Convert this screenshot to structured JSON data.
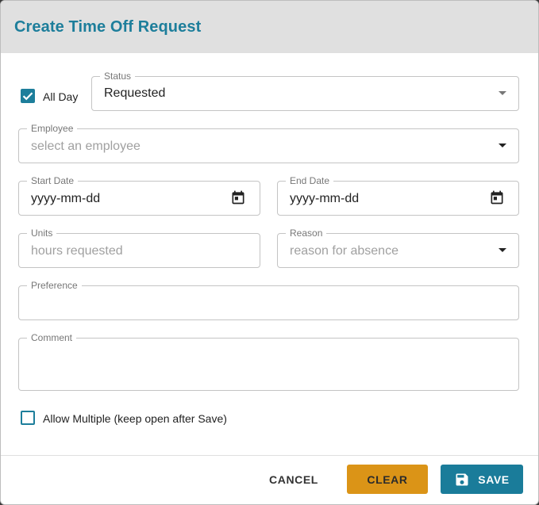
{
  "dialog": {
    "title": "Create Time Off Request"
  },
  "form": {
    "all_day": {
      "label": "All Day",
      "checked": true
    },
    "status": {
      "label": "Status",
      "value": "Requested"
    },
    "employee": {
      "label": "Employee",
      "placeholder": "select an employee"
    },
    "start_date": {
      "label": "Start Date",
      "value": "yyyy-mm-dd"
    },
    "end_date": {
      "label": "End Date",
      "value": "yyyy-mm-dd"
    },
    "units": {
      "label": "Units",
      "placeholder": "hours requested"
    },
    "reason": {
      "label": "Reason",
      "placeholder": "reason for absence"
    },
    "preference": {
      "label": "Preference",
      "value": ""
    },
    "comment": {
      "label": "Comment",
      "value": ""
    },
    "allow_multiple": {
      "label": "Allow Multiple (keep open after Save)",
      "checked": false
    }
  },
  "actions": {
    "cancel_label": "CANCEL",
    "clear_label": "CLEAR",
    "save_label": "SAVE"
  },
  "colors": {
    "accent": "#1d7e9b",
    "clear_button": "#db9417",
    "header_bg": "#e0e0e0"
  },
  "icons": {
    "calendar": "calendar-icon",
    "save": "floppy-disk-icon",
    "check": "checkmark-icon",
    "dropdown": "chevron-down-icon"
  }
}
